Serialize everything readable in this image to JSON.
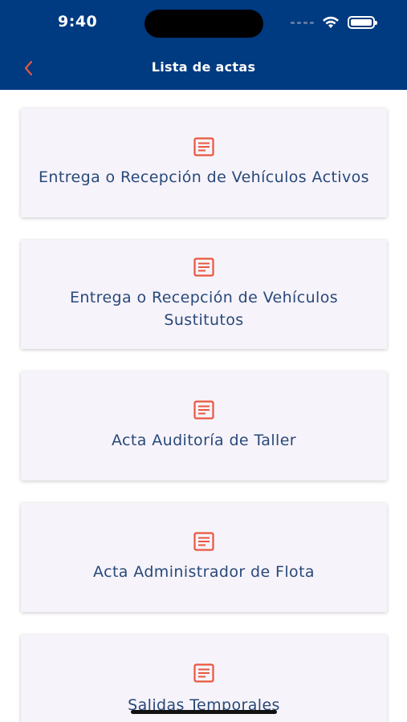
{
  "status_bar": {
    "time": "9:40"
  },
  "nav": {
    "title": "Lista de actas",
    "back_icon": "chevron-left-icon"
  },
  "colors": {
    "header": "#003a80",
    "accent": "#e8573f",
    "card_text": "#27497a",
    "card_bg": "#f7f3fa"
  },
  "cards": [
    {
      "icon": "document-icon",
      "label": "Entrega o Recepción de Vehículos Activos"
    },
    {
      "icon": "document-icon",
      "label": "Entrega o Recepción de Vehículos Sustitutos"
    },
    {
      "icon": "document-icon",
      "label": "Acta Auditoría de Taller"
    },
    {
      "icon": "document-icon",
      "label": "Acta Administrador de Flota"
    },
    {
      "icon": "document-icon",
      "label": "Salidas Temporales"
    }
  ]
}
